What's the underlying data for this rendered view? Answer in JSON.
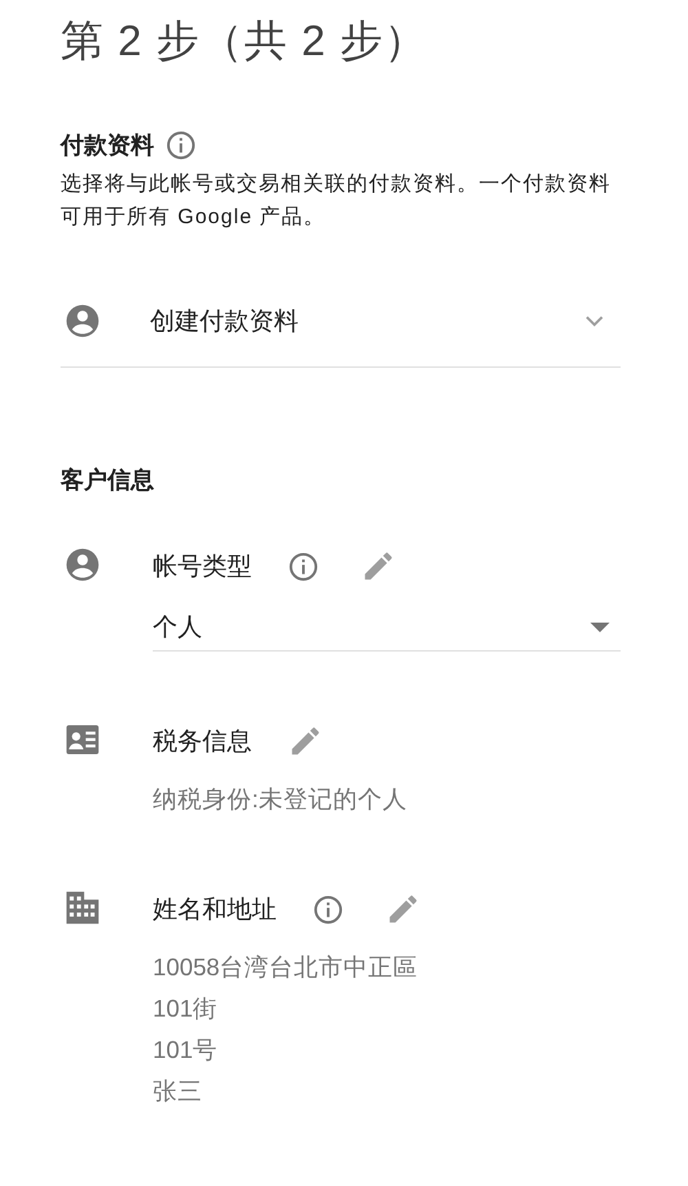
{
  "title": "第 2 步（共 2 步）",
  "payment_profile": {
    "heading": "付款资料",
    "info": true,
    "description": "选择将与此帐号或交易相关联的付款资料。一个付款资料可用于所有 Google 产品。",
    "selector": {
      "label": "创建付款资料"
    }
  },
  "customer_info": {
    "heading": "客户信息",
    "sections": [
      {
        "kind": "account_type",
        "label": "帐号类型",
        "info": true,
        "editable": true,
        "select": {
          "value": "个人"
        }
      },
      {
        "kind": "tax",
        "label": "税务信息",
        "info": false,
        "editable": true,
        "lines": [
          "纳税身份:未登记的个人"
        ]
      },
      {
        "kind": "address",
        "label": "姓名和地址",
        "info": true,
        "editable": true,
        "lines": [
          "10058台湾台北市中正區",
          "101街",
          "101号",
          "张三"
        ]
      }
    ]
  }
}
